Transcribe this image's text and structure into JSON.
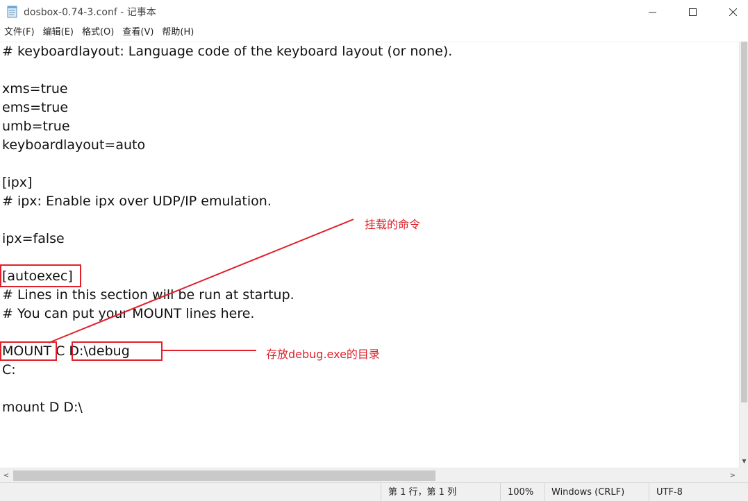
{
  "window": {
    "title": "dosbox-0.74-3.conf - 记事本"
  },
  "menu": [
    "文件(F)",
    "编辑(E)",
    "格式(O)",
    "查看(V)",
    "帮助(H)"
  ],
  "editor": {
    "lines": [
      "# keyboardlayout: Language code of the keyboard layout (or none).",
      "",
      "xms=true",
      "ems=true",
      "umb=true",
      "keyboardlayout=auto",
      "",
      "[ipx]",
      "# ipx: Enable ipx over UDP/IP emulation.",
      "",
      "ipx=false",
      "",
      "[autoexec]",
      "# Lines in this section will be run at startup.",
      "# You can put your MOUNT lines here.",
      "",
      "MOUNT C D:\\debug",
      "C:",
      "",
      "mount D D:\\"
    ]
  },
  "annotations": {
    "mount_command_label": "挂载的命令",
    "debug_dir_label": "存放debug.exe的目录",
    "color": "#e0202a"
  },
  "statusbar": {
    "position": "第 1 行，第 1 列",
    "zoom": "100%",
    "line_ending": "Windows (CRLF)",
    "encoding": "UTF-8"
  },
  "icons": {
    "app": "notepad-icon",
    "minimize": "minimize-icon",
    "maximize": "maximize-icon",
    "close": "close-icon"
  }
}
